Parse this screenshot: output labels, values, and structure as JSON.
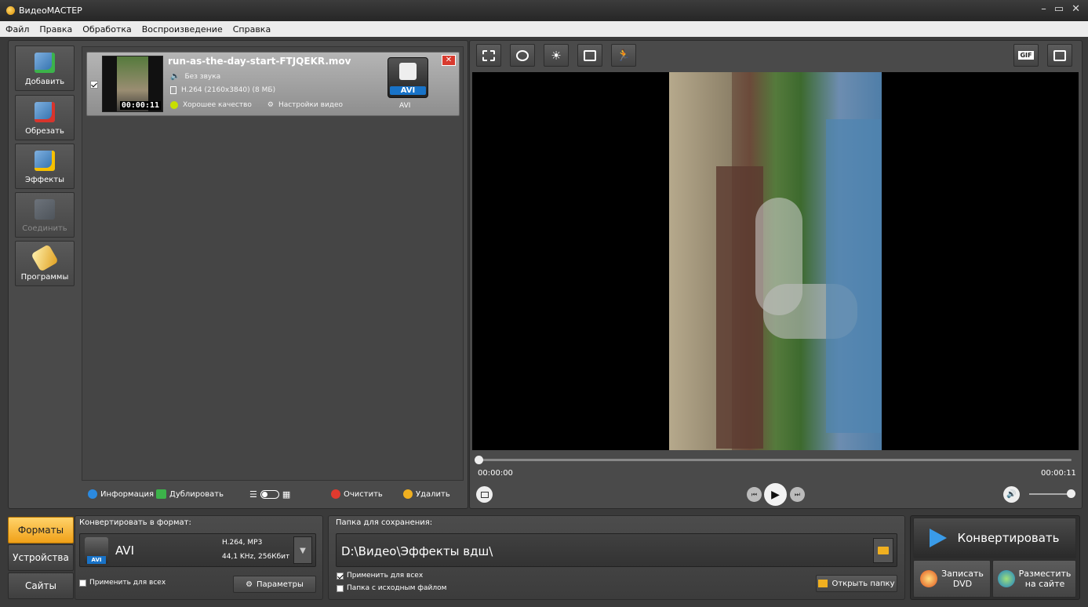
{
  "window": {
    "title": "ВидеоМАСТЕР"
  },
  "menu": {
    "items": [
      "Файл",
      "Правка",
      "Обработка",
      "Воспроизведение",
      "Справка"
    ]
  },
  "sidebar": {
    "items": [
      {
        "label": "Добавить",
        "icon": "add-video-icon"
      },
      {
        "label": "Обрезать",
        "icon": "scissors-icon"
      },
      {
        "label": "Эффекты",
        "icon": "magic-wand-icon"
      },
      {
        "label": "Соединить",
        "icon": "join-icon",
        "disabled": true
      },
      {
        "label": "Программы",
        "icon": "programs-icon"
      }
    ]
  },
  "file": {
    "name": "run-as-the-day-start-FTJQEKR.mov",
    "audio": "Без звука",
    "video": "H.264 (2160x3840) (8 МБ)",
    "quality": "Хорошее качество",
    "settings": "Настройки видео",
    "duration": "00:00:11",
    "format_badge": "AVI",
    "format_caption": "AVI",
    "checked": true
  },
  "list_toolbar": {
    "info": "Информация",
    "duplicate": "Дублировать",
    "clear": "Очистить",
    "delete": "Удалить"
  },
  "player": {
    "time_start": "00:00:00",
    "time_end": "00:00:11",
    "progress": 0,
    "volume": 1.0
  },
  "bottom": {
    "tabs": [
      "Форматы",
      "Устройства",
      "Сайты"
    ],
    "active_tab": "Форматы",
    "format_label": "Конвертировать в формат:",
    "format_name": "AVI",
    "format_badge": "AVI",
    "format_codec": "H.264, MP3",
    "format_audio": "44,1 KHz, 256Кбит",
    "apply_all": "Применить для всех",
    "params": "Параметры",
    "save_label": "Папка для сохранения:",
    "save_path": "D:\\Видео\\Эффекты вдш\\",
    "save_apply_all": "Применить для всех",
    "save_source_folder": "Папка с исходным файлом",
    "open_folder": "Открыть папку",
    "convert": "Конвертировать",
    "burn_dvd_line1": "Записать",
    "burn_dvd_line2": "DVD",
    "publish_line1": "Разместить",
    "publish_line2": "на сайте"
  },
  "colors": {
    "accent": "#f0a018",
    "badge_blue": "#1873c8"
  }
}
